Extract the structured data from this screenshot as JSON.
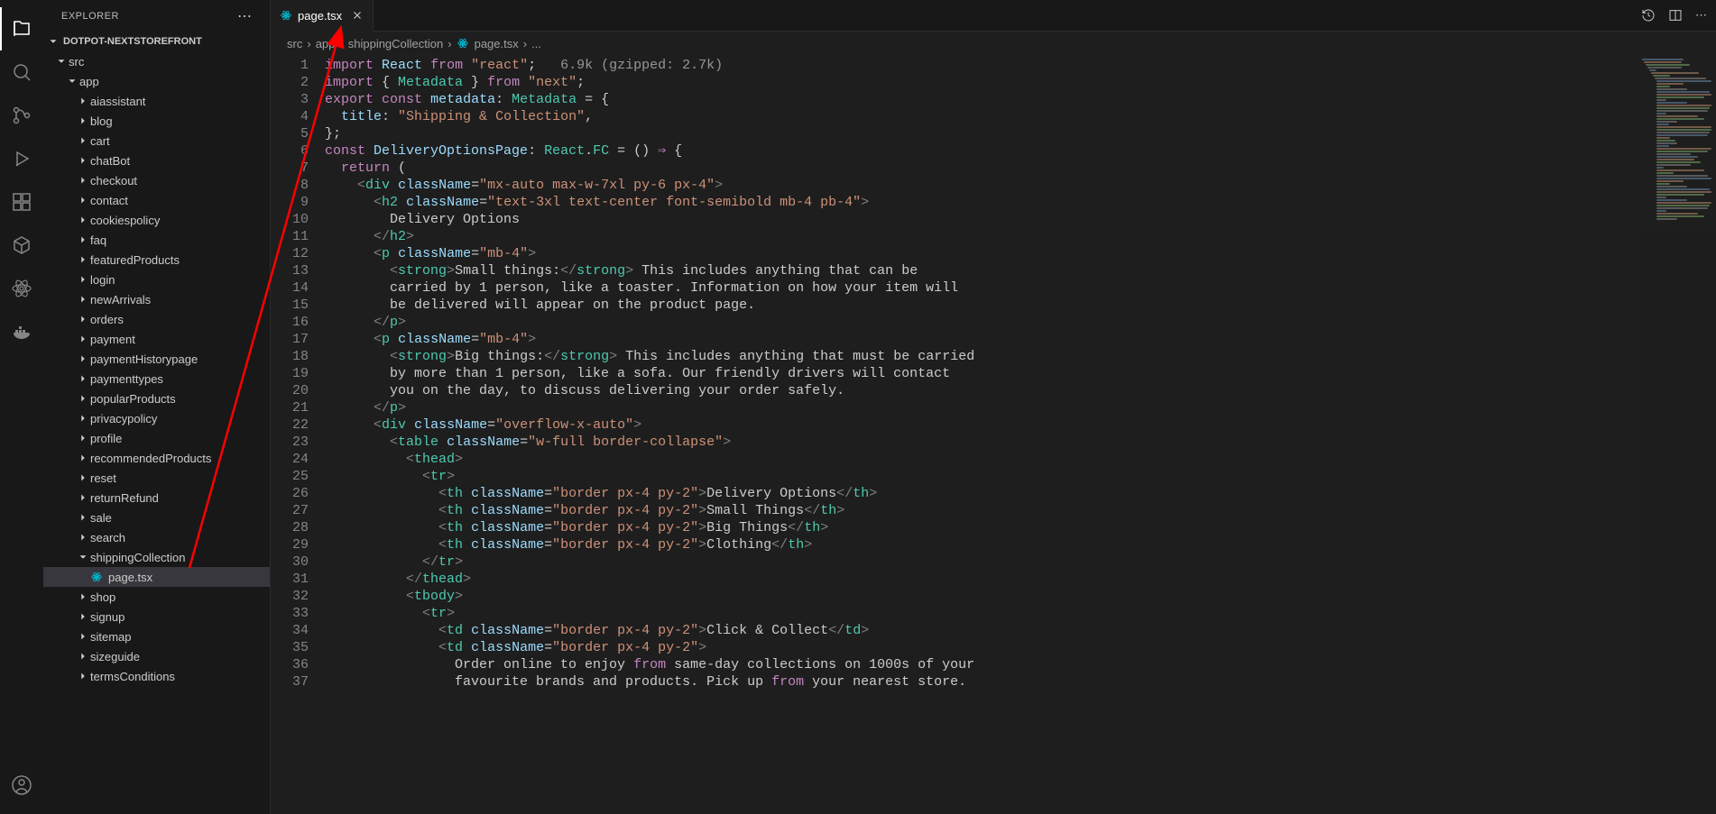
{
  "sidebar": {
    "title": "EXPLORER",
    "workspace": "DOTPOT-NEXTSTOREFRONT",
    "tree": {
      "src": "src",
      "app": "app",
      "folders": [
        "aiassistant",
        "blog",
        "cart",
        "chatBot",
        "checkout",
        "contact",
        "cookiespolicy",
        "faq",
        "featuredProducts",
        "login",
        "newArrivals",
        "orders",
        "payment",
        "paymentHistorypage",
        "paymenttypes",
        "popularProducts",
        "privacypolicy",
        "profile",
        "recommendedProducts",
        "reset",
        "returnRefund",
        "sale",
        "search"
      ],
      "shipping": "shippingCollection",
      "file": "page.tsx",
      "after": [
        "shop",
        "signup",
        "sitemap",
        "sizeguide",
        "termsConditions"
      ]
    }
  },
  "tab": {
    "label": "page.tsx"
  },
  "breadcrumbs": [
    "src",
    "app",
    "shippingCollection",
    "page.tsx",
    "..."
  ],
  "lines": [
    "1",
    "2",
    "3",
    "4",
    "5",
    "6",
    "7",
    "8",
    "9",
    "10",
    "11",
    "12",
    "13",
    "14",
    "15",
    "16",
    "17",
    "18",
    "19",
    "20",
    "21",
    "22",
    "23",
    "24",
    "25",
    "26",
    "27",
    "28",
    "29",
    "30",
    "31",
    "32",
    "33",
    "34",
    "35",
    "36",
    "37"
  ],
  "code": {
    "l1a": "import",
    "l1b": "React",
    "l1c": "from",
    "l1d": "\"react\"",
    "l1e": ";",
    "l1hint": "6.9k (gzipped: 2.7k)",
    "l2": "import { Metadata } from \"next\";",
    "l3": "export const metadata: Metadata = {",
    "l4": "  title: \"Shipping & Collection\",",
    "l5": "};",
    "l6": "const DeliveryOptionsPage: React.FC = () ⇒ {",
    "l7": "  return (",
    "l8": "    <div className=\"mx-auto max-w-7xl py-6 px-4\">",
    "l9": "      <h2 className=\"text-3xl text-center font-semibold mb-4 pb-4\">",
    "l10": "        Delivery Options",
    "l11": "      </h2>",
    "l12": "      <p className=\"mb-4\">",
    "l13": "        <strong>Small things:</strong> This includes anything that can be",
    "l14": "        carried by 1 person, like a toaster. Information on how your item will",
    "l15": "        be delivered will appear on the product page.",
    "l16": "      </p>",
    "l17": "      <p className=\"mb-4\">",
    "l18": "        <strong>Big things:</strong> This includes anything that must be carried",
    "l19": "        by more than 1 person, like a sofa. Our friendly drivers will contact",
    "l20": "        you on the day, to discuss delivering your order safely.",
    "l21": "      </p>",
    "l22": "      <div className=\"overflow-x-auto\">",
    "l23": "        <table className=\"w-full border-collapse\">",
    "l24": "          <thead>",
    "l25": "            <tr>",
    "l26": "              <th className=\"border px-4 py-2\">Delivery Options</th>",
    "l27": "              <th className=\"border px-4 py-2\">Small Things</th>",
    "l28": "              <th className=\"border px-4 py-2\">Big Things</th>",
    "l29": "              <th className=\"border px-4 py-2\">Clothing</th>",
    "l30": "            </tr>",
    "l31": "          </thead>",
    "l32": "          <tbody>",
    "l33": "            <tr>",
    "l34": "              <td className=\"border px-4 py-2\">Click & Collect</td>",
    "l35": "              <td className=\"border px-4 py-2\">",
    "l36": "                Order online to enjoy from same-day collections on 1000s of your",
    "l37": "                favourite brands and products. Pick up from your nearest store."
  }
}
